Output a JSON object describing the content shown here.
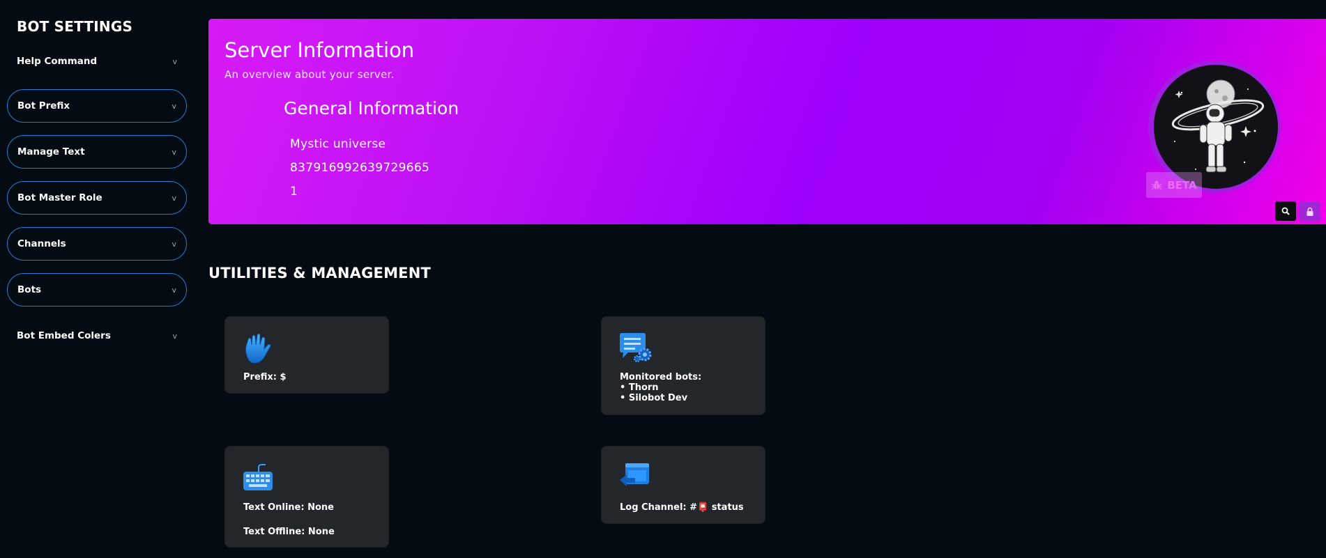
{
  "sidebar": {
    "title": "BOT SETTINGS",
    "chevron": "v",
    "items": [
      {
        "label": "Help Command",
        "bordered": false
      },
      {
        "label": "Bot Prefix",
        "bordered": true
      },
      {
        "label": "Manage Text",
        "bordered": true
      },
      {
        "label": "Bot Master Role",
        "bordered": true
      },
      {
        "label": "Channels",
        "bordered": true
      },
      {
        "label": "Bots",
        "bordered": true
      },
      {
        "label": "Bot Embed Colers",
        "bordered": false
      }
    ]
  },
  "banner": {
    "title": "Server Information",
    "subtitle": "An overview about your server.",
    "general_title": "General Information",
    "server_name": "Mystic universe",
    "server_id": "837916992639729665",
    "member_count": "1",
    "beta_label": "BETA",
    "colors": {
      "start": "#d71bf5",
      "mid": "#9d00fb",
      "end": "#f200e8"
    }
  },
  "section": {
    "title": "UTILITIES & MANAGEMENT"
  },
  "cards": {
    "prefix": {
      "text": "Prefix: $",
      "icon": "waving-hand-icon"
    },
    "monitored": {
      "heading": "Monitored bots:",
      "bots": [
        "• Thorn",
        "• Silobot Dev"
      ],
      "icon": "chat-gear-icon"
    },
    "text_status": {
      "online": "Text Online: None",
      "offline": "Text Offline: None",
      "icon": "keyboard-icon"
    },
    "log": {
      "text": "Log Channel: #📮 status",
      "icon": "window-arrow-icon"
    }
  },
  "icons": [
    "search-icon",
    "lock-icon",
    "bug-icon"
  ]
}
